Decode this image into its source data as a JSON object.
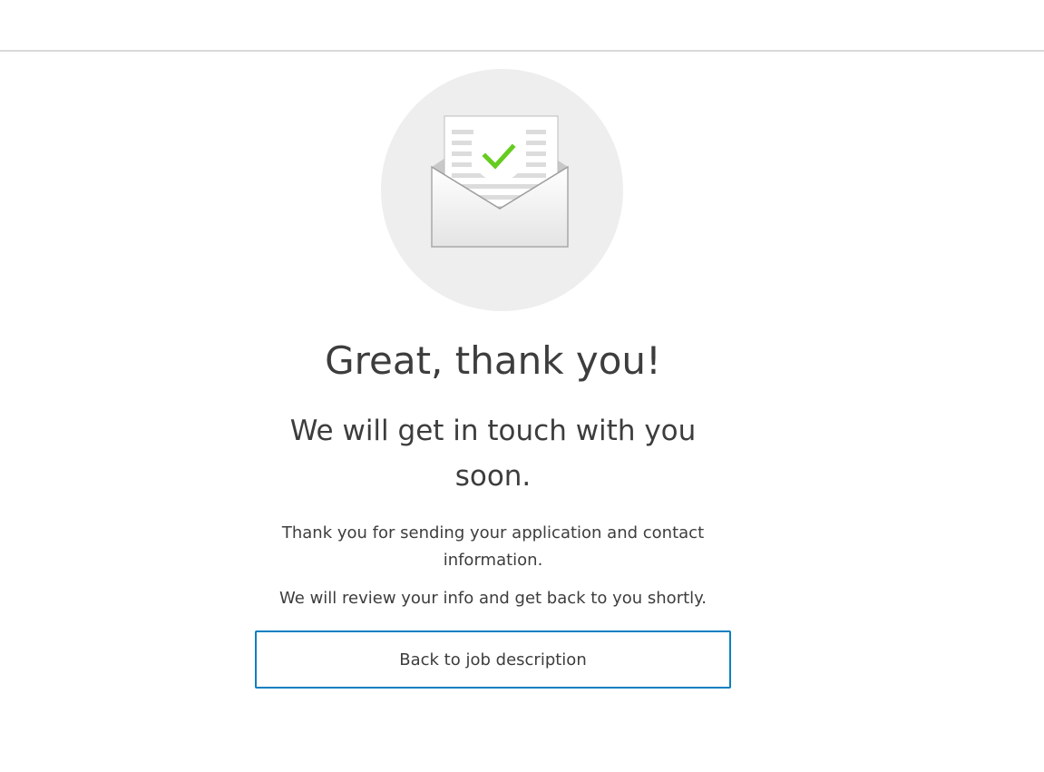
{
  "illustration": {
    "icon": "envelope-check-icon",
    "circle_color": "#eeeeee",
    "check_color": "#66cc1f"
  },
  "headline": "Great, thank you!",
  "subheadline": "We will get in touch with you soon.",
  "messages": [
    "Thank you for sending your application and contact information.",
    "We will review your info and get back to you shortly."
  ],
  "back_button": {
    "label": "Back to job description",
    "border_color": "#0a7fc1"
  }
}
